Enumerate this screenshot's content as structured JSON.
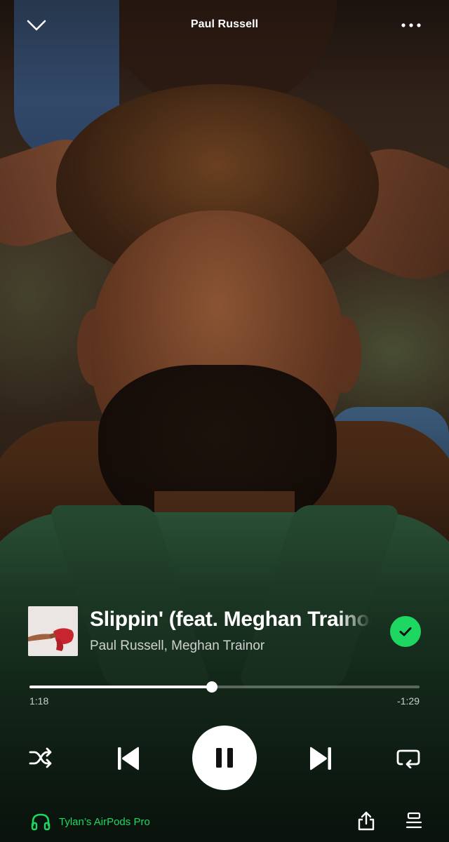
{
  "header": {
    "title": "Paul Russell",
    "collapse_icon": "chevron-down-icon",
    "more_icon": "more-options-icon"
  },
  "track": {
    "title": "Slippin' (feat. Meghan Trainor)",
    "artists": "Paul Russell, Meghan Trainor",
    "liked": true,
    "liked_color": "#1ed760"
  },
  "playback": {
    "elapsed": "1:18",
    "remaining": "-1:29",
    "progress_fraction": 0.467,
    "state": "playing"
  },
  "controls": {
    "shuffle_icon": "shuffle-icon",
    "previous_icon": "skip-previous-icon",
    "pause_icon": "pause-icon",
    "next_icon": "skip-next-icon",
    "repeat_icon": "repeat-icon"
  },
  "bottom_bar": {
    "device_label": "Tylan’s AirPods Pro",
    "device_icon": "headphones-icon",
    "device_color": "#1ed760",
    "share_icon": "share-icon",
    "queue_icon": "queue-icon"
  }
}
